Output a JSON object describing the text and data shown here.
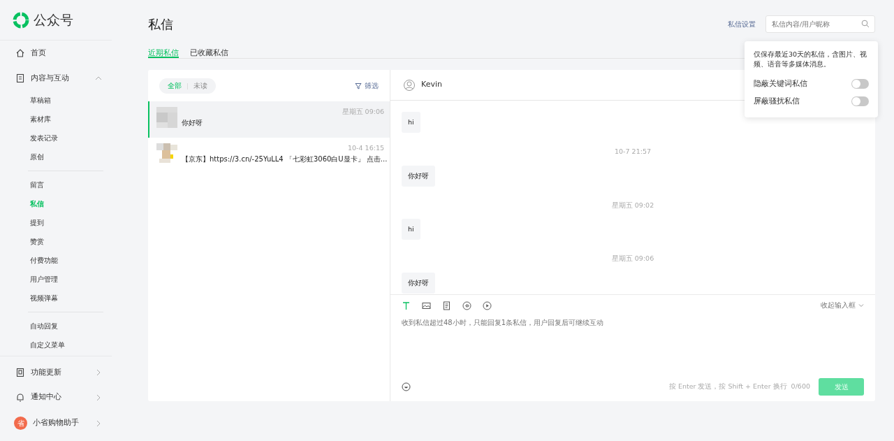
{
  "logo": {
    "text": "公众号"
  },
  "nav": [
    {
      "label": "首页",
      "selected": false
    },
    {
      "label": "内容与互动",
      "selected": false,
      "expanded": true,
      "groups": [
        [
          {
            "label": "草稿箱",
            "selected": false
          },
          {
            "label": "素材库",
            "selected": false
          },
          {
            "label": "发表记录",
            "selected": false
          },
          {
            "label": "原创",
            "selected": false
          }
        ],
        [
          {
            "label": "留言",
            "selected": false
          },
          {
            "label": "私信",
            "selected": true
          },
          {
            "label": "提到",
            "selected": false
          },
          {
            "label": "赞赏",
            "selected": false
          },
          {
            "label": "付费功能",
            "selected": false
          },
          {
            "label": "用户管理",
            "selected": false
          },
          {
            "label": "视频弹幕",
            "selected": false
          }
        ],
        [
          {
            "label": "自动回复",
            "selected": false
          },
          {
            "label": "自定义菜单",
            "selected": false
          }
        ]
      ]
    }
  ],
  "nav_bottom": [
    {
      "label": "功能更新",
      "selected": false,
      "expanded": false
    },
    {
      "label": "通知中心",
      "selected": false,
      "expanded": false
    },
    {
      "label": "小省购物助手",
      "selected": false,
      "expanded": false,
      "badge": "省"
    }
  ],
  "page": {
    "title": "私信",
    "settings_link": "私信设置",
    "search": {
      "placeholder": "私信内容/用户昵称"
    }
  },
  "tabs": [
    {
      "label": "近期私信",
      "selected": true
    },
    {
      "label": "已收藏私信",
      "selected": false
    }
  ],
  "popover": {
    "note": "仅保存最近30天的私信，含图片、视频、语音等多媒体消息。",
    "toggles": [
      {
        "label": "隐蔽关键词私信",
        "on": false
      },
      {
        "label": "屏蔽骚扰私信",
        "on": false
      }
    ]
  },
  "conversation_list": {
    "filters": [
      {
        "label": "全部",
        "selected": true
      },
      {
        "label": "未读",
        "selected": false
      }
    ],
    "filter_button": "筛选",
    "conversations": [
      {
        "time": "星期五 09:06",
        "preview": "你好呀",
        "selected": true
      },
      {
        "time": "10-4 16:15",
        "preview": "【京东】https://3.cn/-25YuLL4 「七彩虹3060白U显卡」 点击...",
        "selected": false
      }
    ]
  },
  "chat": {
    "contact": "Kevin",
    "messages": [
      {
        "kind": "bubble",
        "text": "hi"
      },
      {
        "kind": "time",
        "text": "10-7 21:57"
      },
      {
        "kind": "bubble",
        "text": "你好呀"
      },
      {
        "kind": "time",
        "text": "星期五 09:02"
      },
      {
        "kind": "bubble",
        "text": "hi"
      },
      {
        "kind": "time",
        "text": "星期五 09:06"
      },
      {
        "kind": "bubble",
        "text": "你好呀"
      }
    ],
    "composer": {
      "tools": [
        {
          "selected": true
        },
        {
          "selected": false
        },
        {
          "selected": false
        },
        {
          "selected": false
        },
        {
          "selected": false
        }
      ],
      "collapse": "收起输入框",
      "placeholder": "收到私信超过48小时，只能回复1条私信，用户回复后可继续互动",
      "hint": "按 Enter 发送，按 Shift + Enter 换行",
      "counter": "0/600",
      "send": {
        "label": "发送",
        "disabled": true
      }
    }
  }
}
